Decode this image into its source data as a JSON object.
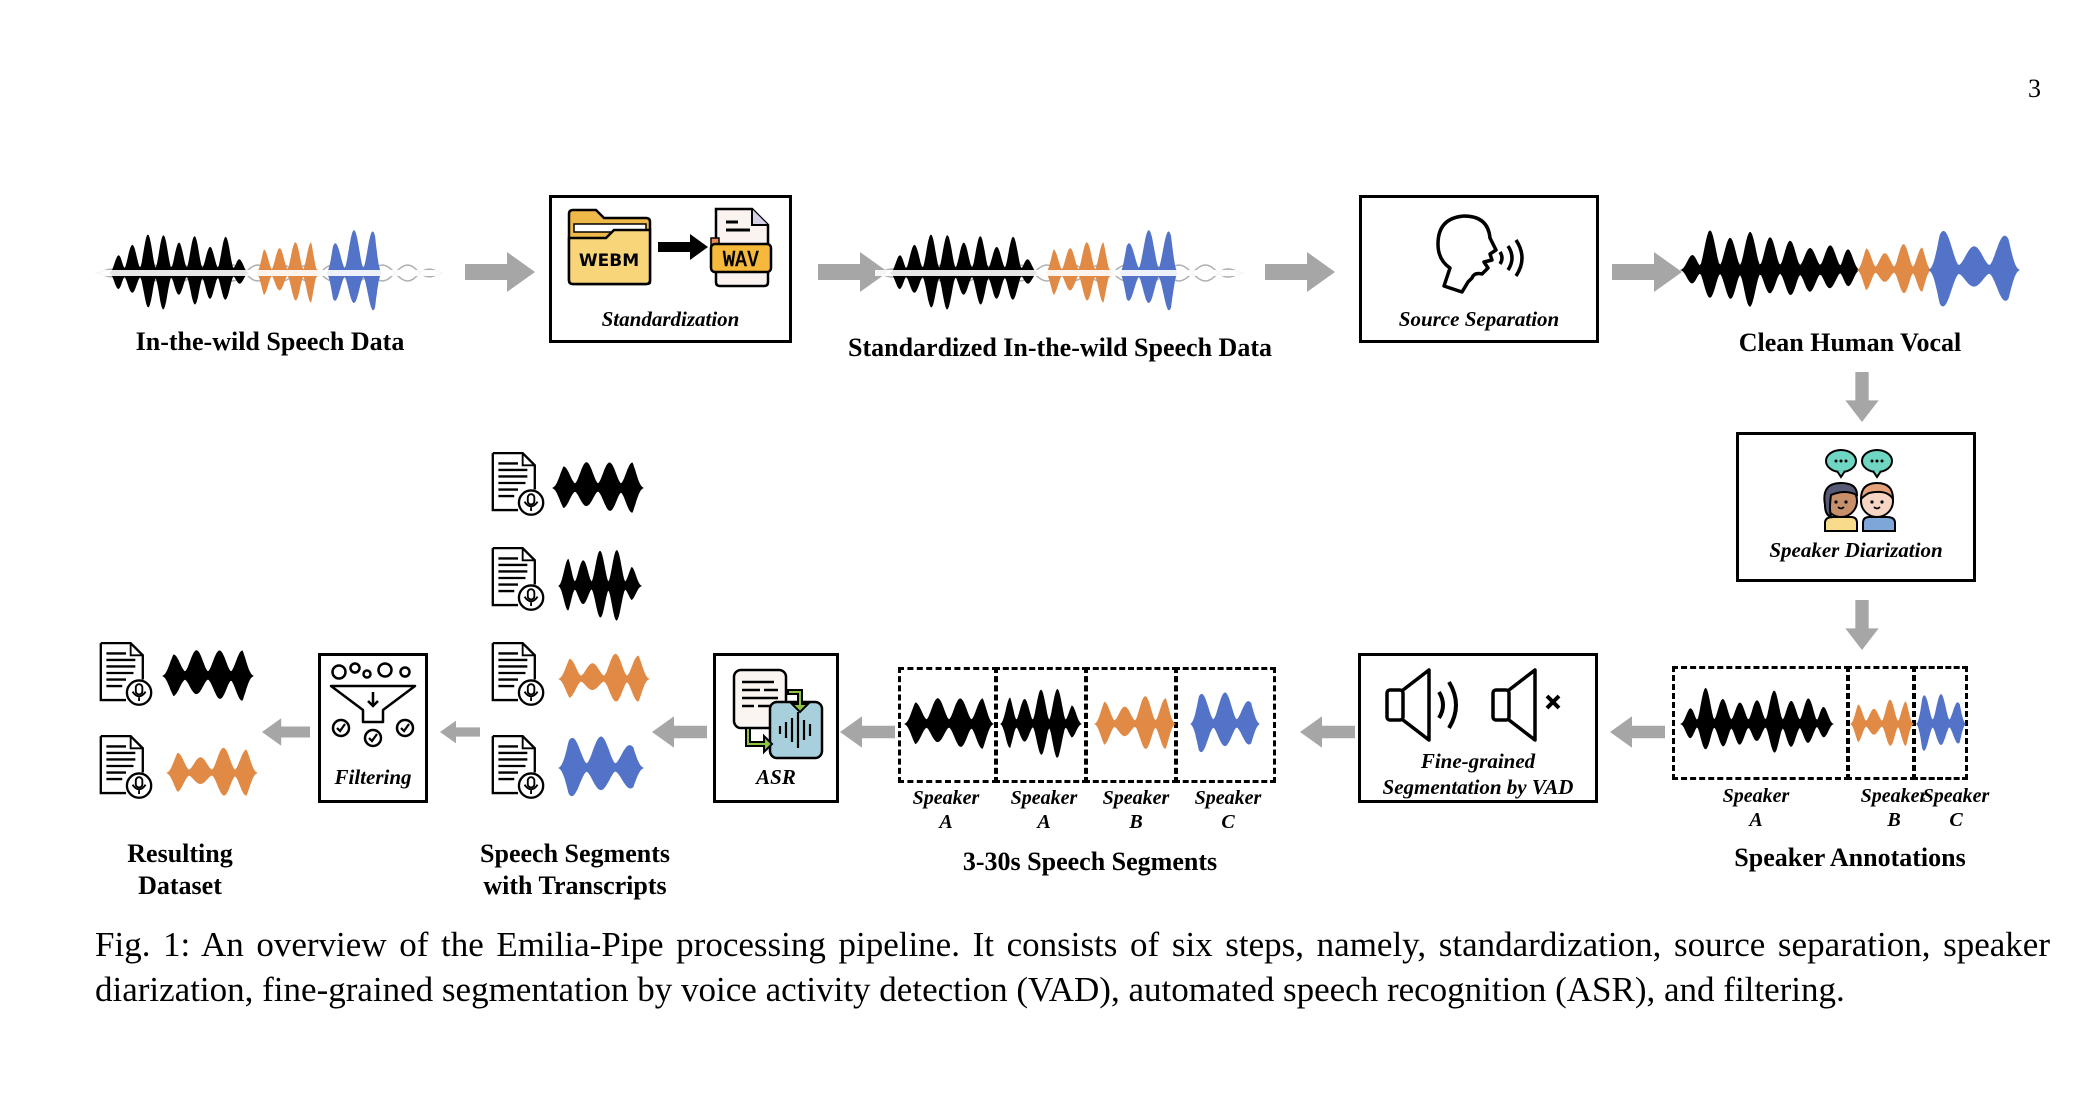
{
  "page_number": "3",
  "colors": {
    "black_wave": "#000000",
    "orange_wave": "#E08A45",
    "blue_wave": "#5273C8",
    "arrow": "#A6A6A6",
    "teal": "#6FD6C4",
    "lightblue": "#A8D0DC",
    "green": "#8CC63F",
    "folder": "#F9D57A"
  },
  "figure": {
    "top_row": {
      "raw_data_label": "In-the-wild Speech Data",
      "standardization": {
        "title": "Standardization",
        "from_format": "WEBM",
        "to_format": "WAV"
      },
      "standardized_label": "Standardized In-the-wild Speech Data",
      "source_separation": {
        "title": "Source Separation"
      },
      "clean_vocal_label": "Clean Human Vocal"
    },
    "speaker_diarization": {
      "title": "Speaker Diarization"
    },
    "speaker_annotations": {
      "label": "Speaker Annotations",
      "speakers": [
        {
          "name": "Speaker",
          "id": "A"
        },
        {
          "name": "Speaker",
          "id": "B"
        },
        {
          "name": "Speaker",
          "id": "C"
        }
      ]
    },
    "vad": {
      "title_line1": "Fine-grained",
      "title_line2": "Segmentation by VAD"
    },
    "segments": {
      "label": "3-30s Speech Segments",
      "speakers": [
        {
          "name": "Speaker",
          "id": "A"
        },
        {
          "name": "Speaker",
          "id": "A"
        },
        {
          "name": "Speaker",
          "id": "B"
        },
        {
          "name": "Speaker",
          "id": "C"
        }
      ]
    },
    "asr": {
      "title": "ASR"
    },
    "transcripts": {
      "label_line1": "Speech Segments",
      "label_line2": "with Transcripts"
    },
    "filtering": {
      "title": "Filtering"
    },
    "result": {
      "label_line1": "Resulting",
      "label_line2": "Dataset"
    }
  },
  "caption": "Fig. 1: An overview of the Emilia-Pipe processing pipeline. It consists of six steps, namely, standardization, source separation, speaker diarization, fine-grained segmentation by voice activity detection (VAD), automated speech recognition (ASR), and filtering."
}
